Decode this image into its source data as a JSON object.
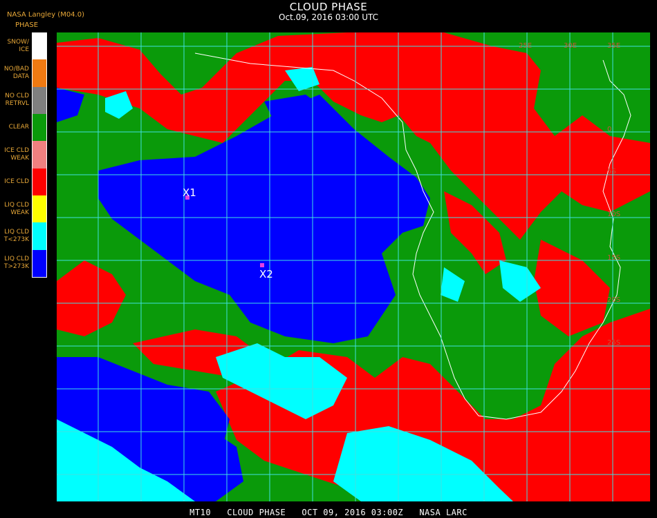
{
  "header": {
    "title": "CLOUD PHASE",
    "subtitle": "Oct.09, 2016 03:00 UTC",
    "provider": "NASA Langley (M04.0)"
  },
  "legend": {
    "heading": "PHASE",
    "items": [
      {
        "label": "SNOW/\nICE",
        "color": "#ffffff"
      },
      {
        "label": "NO/BAD\nDATA",
        "color": "#f07a12"
      },
      {
        "label": "NO CLD\nRETRVL",
        "color": "#7f7f7f"
      },
      {
        "label": "CLEAR",
        "color": "#0a9a0a"
      },
      {
        "label": "ICE CLD\nWEAK",
        "color": "#f08080"
      },
      {
        "label": "ICE CLD",
        "color": "#ff0000"
      },
      {
        "label": "LIQ CLD\nWEAK",
        "color": "#ffff00"
      },
      {
        "label": "LIQ CLD\nT<273K",
        "color": "#00ffff"
      },
      {
        "label": "LIQ CLD\nT>273K",
        "color": "#0000ff"
      }
    ]
  },
  "map": {
    "markers": [
      {
        "label": "X1",
        "color": "#e040e0"
      },
      {
        "label": "X2",
        "color": "#e040e0"
      }
    ],
    "grid_labels": [
      "25E",
      "30E",
      "35E",
      "0",
      "5S",
      "10S",
      "15S",
      "20S",
      "25S"
    ],
    "colors": {
      "grid": "#40e0e0",
      "coast": "#ffffff",
      "ice": "#ff0000",
      "clear": "#0a9a0a",
      "liquid": "#0000ff",
      "cold_liquid": "#00ffff"
    }
  },
  "footer": {
    "text": "MT10   CLOUD PHASE   OCT 09, 2016 03:00Z   NASA LARC"
  }
}
